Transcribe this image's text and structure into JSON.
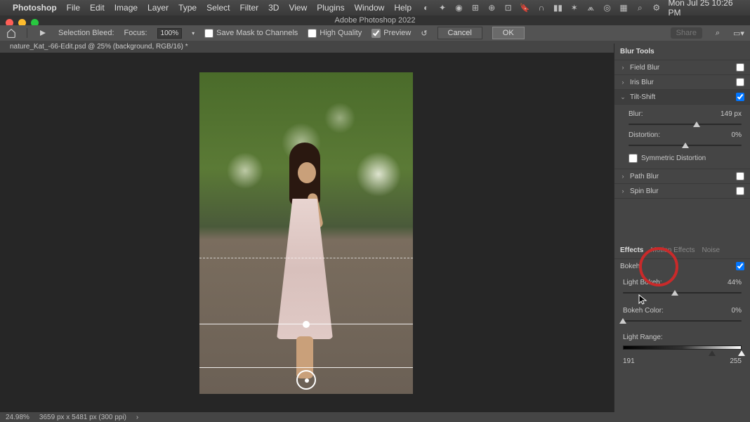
{
  "menubar": {
    "app": "Photoshop",
    "items": [
      "File",
      "Edit",
      "Image",
      "Layer",
      "Type",
      "Select",
      "Filter",
      "3D",
      "View",
      "Plugins",
      "Window",
      "Help"
    ],
    "clock": "Mon Jul 25  10:26 PM"
  },
  "window_title": "Adobe Photoshop 2022",
  "options": {
    "selection_bleed_label": "Selection Bleed:",
    "focus_label": "Focus:",
    "focus_value": "100%",
    "save_mask": "Save Mask to Channels",
    "high_quality": "High Quality",
    "preview": "Preview",
    "cancel": "Cancel",
    "ok": "OK",
    "share": "Share"
  },
  "tab": "nature_Kat_-66-Edit.psd @ 25% (background, RGB/16) *",
  "blur_tools": {
    "title": "Blur Tools",
    "field_blur": "Field Blur",
    "iris_blur": "Iris Blur",
    "tilt_shift": "Tilt-Shift",
    "blur_label": "Blur:",
    "blur_value": "149 px",
    "distortion_label": "Distortion:",
    "distortion_value": "0%",
    "sym_distortion": "Symmetric Distortion",
    "path_blur": "Path Blur",
    "spin_blur": "Spin Blur"
  },
  "effects": {
    "tabs": {
      "effects": "Effects",
      "motion": "Motion Effects",
      "noise": "Noise"
    },
    "bokeh": "Bokeh",
    "light_bokeh_label": "Light Bokeh:",
    "light_bokeh_value": "44%",
    "bokeh_color_label": "Bokeh Color:",
    "bokeh_color_value": "0%",
    "light_range_label": "Light Range:",
    "range_min": "191",
    "range_max": "255"
  },
  "status": {
    "zoom": "24.98%",
    "dims": "3659 px x 5481 px (300 ppi)"
  }
}
